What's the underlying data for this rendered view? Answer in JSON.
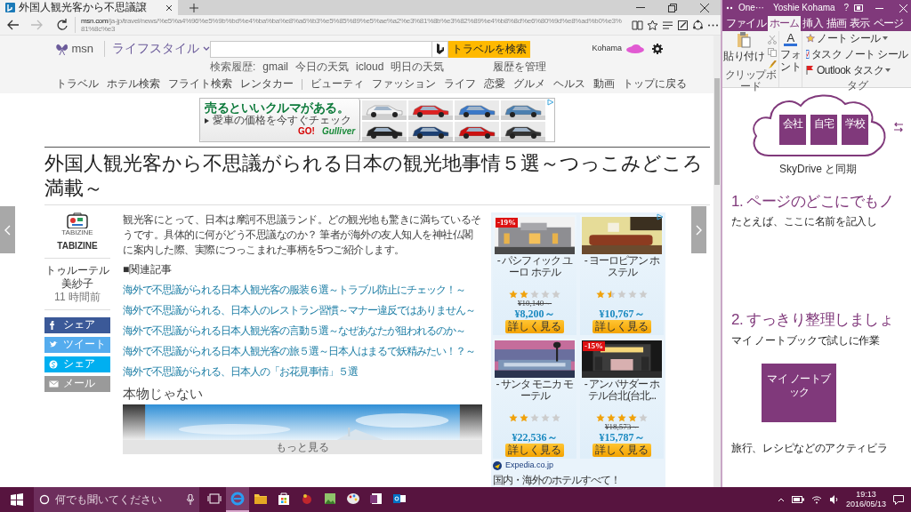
{
  "browser": {
    "tab": {
      "title": "外国人観光客から不思議譲",
      "selected": true
    },
    "nav_buttons": [
      {
        "kind": "back",
        "disabled": false
      },
      {
        "kind": "forward",
        "disabled": true
      },
      {
        "kind": "refresh",
        "disabled": false
      }
    ],
    "address": {
      "host": "msn.com",
      "path": "/ja-jp/travel/news/%e5%a4%96%e5%9b%bd%e4%ba%ba%e8%a6%b3%e5%85%89%e5%ae%a2%e3%81%8b%e3%82%89%e4%b8%8d%e6%80%9d%e8%ad%b0%e3%81%8c%e3"
    }
  },
  "site": {
    "brand": "msn",
    "section": "ライフスタイル",
    "search_button": "トラベルを検索",
    "history_label": "検索履歴:",
    "history": [
      "gmail",
      "今日の天気",
      "icloud",
      "明日の天気"
    ],
    "manage_history": "履歴を管理",
    "user": "Kohama",
    "nav_groups": [
      [
        "トラベル",
        "ホテル検索",
        "フライト検索",
        "レンタカー"
      ],
      [
        "ビューティ",
        "ファッション",
        "ライフ",
        "恋愛",
        "グルメ",
        "ヘルス",
        "動画",
        "トップに戻る"
      ]
    ]
  },
  "banner_ad": {
    "headline": "売るといいクルマがある。",
    "subline": "愛車の価格を今すぐチェック",
    "cta": "GO!",
    "brand": "Gulliver"
  },
  "article": {
    "title": "外国人観光客から不思議がられる日本の観光地事情５選～つっこみどころ満載～",
    "source": {
      "logo_text": "TABIZINE",
      "name": "TABIZINE"
    },
    "author": "トゥルーテル美紗子",
    "time": "11 時間前",
    "share": [
      {
        "kind": "facebook",
        "label": "シェア"
      },
      {
        "kind": "twitter",
        "label": "ツイート"
      },
      {
        "kind": "skype",
        "label": "シェア"
      },
      {
        "kind": "mail",
        "label": "メール"
      }
    ],
    "body": "観光客にとって、日本は摩訶不思議ランド。どの観光地も驚きに満ちているそうです。具体的に何がどう不思議なのか？ 筆者が海外の友人知人を神社仏閣に案内した際、実際につっこまれた事柄を5つご紹介します。",
    "related_heading": "■関連記事",
    "related": [
      "海外で不思議がられる日本人観光客の服装６選～トラブル防止にチェック！～",
      "海外で不思議がられる、日本人のレストラン習慣～マナー違反ではありません～",
      "海外で不思議がられる日本人観光客の言動５選～なぜあなたが狙われるのか～",
      "海外で不思議がられる日本人観光客の旅５選～日本人はまるで妖精みたい！？～",
      "海外で不思議がられる、日本人の「お花見事情」５選"
    ],
    "subheading": "本物じゃない",
    "more": "もっと見る"
  },
  "hotel_ad": {
    "hotels": [
      {
        "discount": "-19%",
        "name": "- パシフィック ユーロ ホテル",
        "stars": 2,
        "old_price": "¥10,140～",
        "price": "¥8,200～",
        "button": "詳しく見る"
      },
      {
        "name": "- ヨーロピアン ホステル",
        "stars": 1.5,
        "price": "¥10,767～",
        "button": "詳しく見る"
      },
      {
        "name": "- サンタ モニカ モーテル",
        "stars": 2,
        "price": "¥22,536～",
        "button": "詳しく見る"
      },
      {
        "discount": "-15%",
        "name": "- アンバサダー ホテル台北(台北...",
        "stars": 4,
        "old_price": "¥18,573～",
        "price": "¥15,787～",
        "button": "詳しく見る"
      }
    ],
    "footer_brand": "Expedia.co.jp",
    "footer_tagline": "国内・海外のホテルすべて！"
  },
  "onenote": {
    "title": "One···",
    "user": "Yoshie Kohama",
    "help": "?",
    "tabs": [
      {
        "label": "ファイル",
        "selected": false
      },
      {
        "label": "ホーム",
        "selected": true
      },
      {
        "label": "挿入",
        "selected": false
      },
      {
        "label": "描画",
        "selected": false
      },
      {
        "label": "表示",
        "selected": false
      },
      {
        "label": "ページ",
        "selected": false
      }
    ],
    "ribbon": {
      "paste": "貼り付け",
      "font_icon": "A",
      "font": "フォント",
      "tags": [
        {
          "kind": "note",
          "label": "ノート シール",
          "dropdown": true
        },
        {
          "kind": "task",
          "label": "タスク ノート シール",
          "dropdown": false
        },
        {
          "kind": "outlook",
          "label": "Outlook タスク",
          "dropdown": true
        }
      ],
      "groups": [
        "クリップボード",
        "タグ"
      ]
    },
    "page": {
      "notebooks": [
        "会社",
        "自宅",
        "学校"
      ],
      "sync_caption": "SkyDrive と同期",
      "steps": [
        {
          "heading": "1. ページのどこにでもノ",
          "text": "たとえば、ここに名前を記入し"
        },
        {
          "heading": "2. すっきり整理しましょ",
          "text": "マイ ノートブックで試しに作業"
        }
      ],
      "notebook_label": "マイ ノートブック",
      "footer": "旅行、レシピなどのアクティビラ"
    }
  },
  "taskbar": {
    "search_placeholder": "何でも聞いてください",
    "apps": [
      {
        "kind": "edge",
        "selected": true
      },
      {
        "kind": "folder",
        "selected": false
      },
      {
        "kind": "store",
        "selected": false
      },
      {
        "kind": "game",
        "selected": false
      },
      {
        "kind": "photos",
        "selected": false
      },
      {
        "kind": "paint",
        "selected": false
      },
      {
        "kind": "onenote",
        "selected": false
      },
      {
        "kind": "outlook",
        "selected": false
      }
    ],
    "time": "19:13",
    "date": "2016/05/13"
  }
}
